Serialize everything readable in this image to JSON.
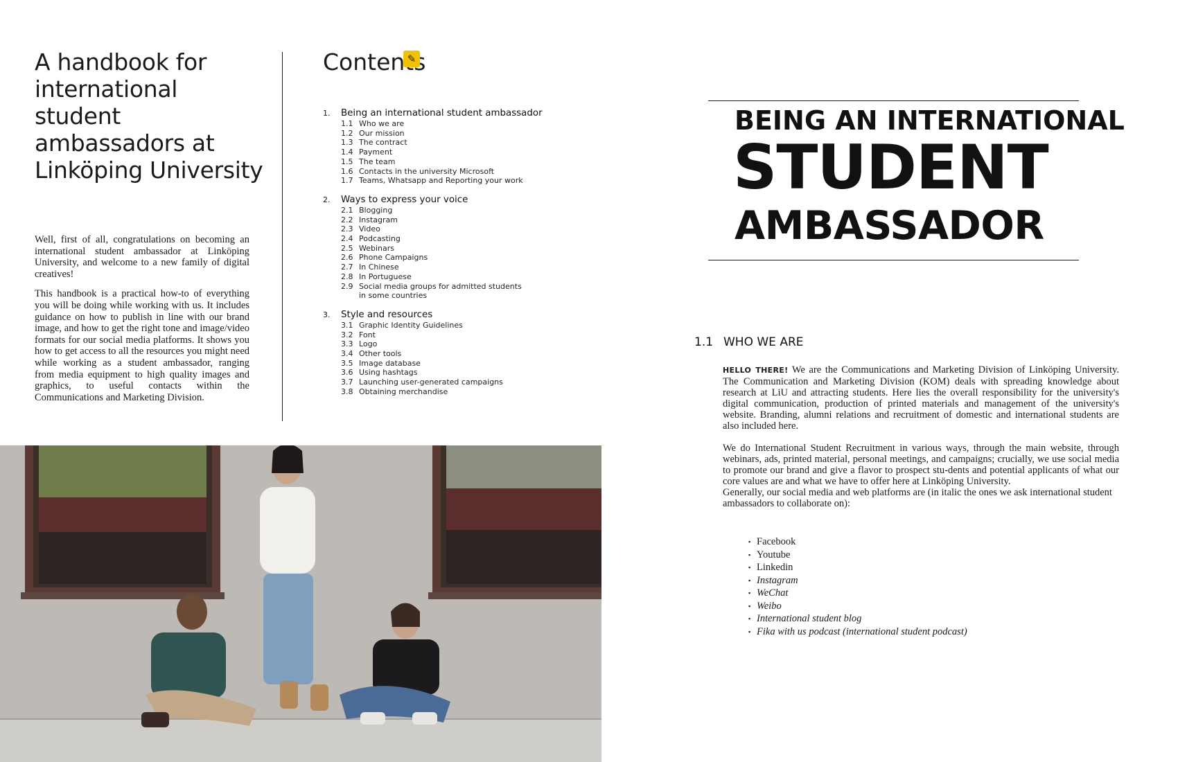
{
  "left_page": {
    "title": "A handbook for international student ambassadors at Linköping University",
    "intro_paragraphs": [
      "Well, first of all, congratulations on becoming an international student ambassador at Linköping University, and welcome to a new family of digital creatives!",
      "This handbook is a practical how-to of everything you will be doing while working with us. It includes guidance on how to publish in line with our brand image, and how to get the right tone and image/video formats for our social media platforms. It shows you how to get access to all the resources you might need while working as a student ambassador, ranging from media equipment to high quality images and graphics, to useful contacts within the Communications and Marketing Division."
    ]
  },
  "contents": {
    "title": "Contents",
    "sections": [
      {
        "num": "1.",
        "title": "Being an international student ambassador",
        "items": [
          {
            "num": "1.1",
            "label": "Who we are"
          },
          {
            "num": "1.2",
            "label": "Our mission"
          },
          {
            "num": "1.3",
            "label": "The contract"
          },
          {
            "num": "1.4",
            "label": "Payment"
          },
          {
            "num": "1.5",
            "label": "The team"
          },
          {
            "num": "1.6",
            "label": "Contacts in the university Microsoft"
          },
          {
            "num": "1.7",
            "label": "Teams, Whatsapp and Reporting your work"
          }
        ]
      },
      {
        "num": "2.",
        "title": "Ways to express your voice",
        "items": [
          {
            "num": "2.1",
            "label": "Blogging"
          },
          {
            "num": "2.2",
            "label": "Instagram"
          },
          {
            "num": "2.3",
            "label": "Video"
          },
          {
            "num": "2.4",
            "label": "Podcasting"
          },
          {
            "num": "2.5",
            "label": "Webinars"
          },
          {
            "num": "2.6",
            "label": "Phone Campaigns"
          },
          {
            "num": "2.7",
            "label": "In Chinese"
          },
          {
            "num": "2.8",
            "label": "In Portuguese"
          },
          {
            "num": "2.9",
            "label": "Social media groups for admitted students"
          },
          {
            "num": "",
            "label": "in some countries"
          }
        ]
      },
      {
        "num": "3.",
        "title": "Style and resources",
        "items": [
          {
            "num": "3.1",
            "label": "Graphic Identity Guidelines"
          },
          {
            "num": "3.2",
            "label": "Font"
          },
          {
            "num": "3.3",
            "label": "Logo"
          },
          {
            "num": "3.4",
            "label": "Other tools"
          },
          {
            "num": "3.5",
            "label": "Image database"
          },
          {
            "num": "3.6",
            "label": "Using hashtags"
          },
          {
            "num": "3.7",
            "label": "Launching user-generated campaigns"
          },
          {
            "num": "3.8",
            "label": "Obtaining merchandise"
          }
        ]
      }
    ]
  },
  "right_page": {
    "hero": {
      "line1": "BEING AN INTERNATIONAL",
      "line2": "STUDENT",
      "line3": "AMBASSADOR"
    },
    "section": {
      "num": "1.1",
      "title": "WHO WE ARE"
    },
    "lead_in": "HELLO THERE!",
    "paragraph1": "We are the Communications and Marketing Division of Linköping University. The Communication and Marketing Division (KOM) deals with spreading knowledge about research at LiU and attracting students. Here lies the overall responsibility for the university's digital communication, production of printed materials and management of the university's website. Branding, alumni relations and recruitment of domestic and international students are also included here.",
    "paragraph2": "We do International Student Recruitment in various ways, through the main website, through webinars, ads, printed material, personal meetings, and campaigns; crucially, we use social media to promote our brand and give a flavor to prospect stu-dents and potential applicants of what our core values are and what we have to offer here at Linköping University.",
    "paragraph3": "Generally, our social media and web platforms are (in italic the ones we ask international student ambassadors to collaborate on):",
    "platforms": [
      {
        "label": "Facebook",
        "italic": false
      },
      {
        "label": "Youtube",
        "italic": false
      },
      {
        "label": "Linkedin",
        "italic": false
      },
      {
        "label": "Instagram",
        "italic": true
      },
      {
        "label": "WeChat",
        "italic": true
      },
      {
        "label": "Weibo",
        "italic": true
      },
      {
        "label": "International student blog",
        "italic": true
      },
      {
        "label": "Fika with us podcast (international student podcast)",
        "italic": true
      }
    ]
  }
}
